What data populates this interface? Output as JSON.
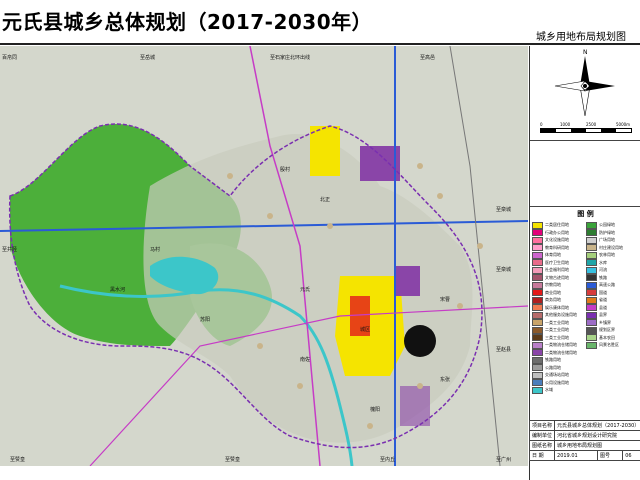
{
  "header": {
    "title": "元氏县城乡总体规划（2017-2030年）",
    "subtitle": "城乡用地布局规划图"
  },
  "map": {
    "edge_labels_top": [
      "百帛同",
      "至岳城",
      "至石家庄北环出线",
      "至高邑"
    ],
    "edge_labels_bottom": [
      "至赞皇",
      "至赞皇",
      "至内丘",
      "至广州"
    ],
    "edge_labels_left": [
      "至井陉"
    ],
    "edge_labels_right": [
      "至栾城",
      "至栾城",
      "至赵县"
    ],
    "place_labels": [
      "元氏",
      "苏阳",
      "殷村",
      "城区",
      "北正",
      "南佐",
      "宋曹",
      "东张",
      "马村",
      "黑水河",
      "槐阳"
    ],
    "colors": {
      "mountain_green": "#4caf3a",
      "rural_base": "#d8d9cf",
      "urban_yellow": "#f5e400",
      "industry_purple": "#8a45a8",
      "water_cyan": "#3cc6c9",
      "highway_blue": "#2a5bd6",
      "road_magenta": "#c63cc6",
      "boundary_purple": "#7a2fb0"
    }
  },
  "legend": {
    "title": "图  例",
    "items_left": [
      "二类居住用地",
      "行政办公用地",
      "文化设施用地",
      "教育科研用地",
      "体育用地",
      "医疗卫生用地",
      "社会福利用地",
      "文物古迹用地",
      "宗教用地",
      "商业用地",
      "商务用地",
      "娱乐康体用地",
      "其他服务设施用地",
      "一类工业用地",
      "二类工业用地",
      "三类工业用地",
      "一类物流仓储用地",
      "二类物流仓储用地",
      "铁路用地",
      "公路用地",
      "交通场站用地",
      "公用设施用地",
      "水域"
    ],
    "items_right": [
      "公园绿地",
      "防护绿地",
      "广场用地",
      "村庄建设用地",
      "农林用地",
      "水库",
      "河流",
      "铁路",
      "高速公路",
      "国道",
      "省道",
      "县道",
      "县界",
      "乡镇界",
      "规划区界",
      "基本农田",
      "风景名胜区"
    ],
    "colors_left": [
      "#f5e400",
      "#e2007a",
      "#ff6fa0",
      "#ff9ecb",
      "#cc66cc",
      "#e96b8a",
      "#f39ab8",
      "#a3536b",
      "#c77a9b",
      "#e31b1b",
      "#b02020",
      "#f07b52",
      "#b76b6b",
      "#c9a46a",
      "#8b5a2b",
      "#5c3b1a",
      "#b980c9",
      "#8a45a8",
      "#6d6d6d",
      "#9c9c9c",
      "#bfbfbf",
      "#4a7dbb",
      "#3cc6c9"
    ],
    "colors_right": [
      "#3aa33a",
      "#2e7d32",
      "#cfcfcf",
      "#c9b48a",
      "#a5cf7c",
      "#1fa5a8",
      "#37c0e0",
      "#333333",
      "#2a5bd6",
      "#d63c3c",
      "#e07b1b",
      "#c63cc6",
      "#7a2fb0",
      "#9c6cc6",
      "#555555",
      "#a8d48a",
      "#69b56b"
    ]
  },
  "scale": {
    "labels": [
      "0",
      "1000",
      "2500",
      "5000m"
    ]
  },
  "title_block": {
    "rows": [
      {
        "k": "项目名称",
        "v": "元氏县城乡总体规划（2017-2030）"
      },
      {
        "k": "编制单位",
        "v": "河北省城乡规划设计研究院"
      },
      {
        "k": "图纸名称",
        "v": "城乡用地布局规划图"
      },
      {
        "k": "日  期",
        "v": "2019.01",
        "k2": "图号",
        "v2": "06"
      }
    ]
  }
}
